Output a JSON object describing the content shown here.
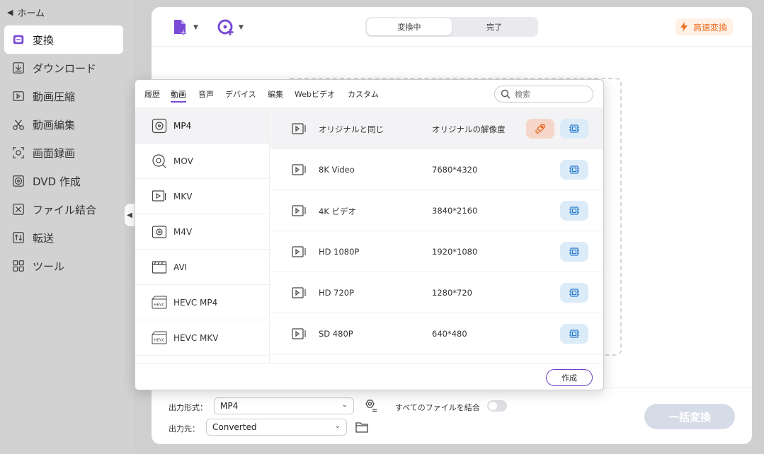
{
  "sidebar": {
    "home": "ホーム",
    "items": [
      {
        "label": "変換",
        "icon": "convert-icon",
        "active": true
      },
      {
        "label": "ダウンロード",
        "icon": "download-icon"
      },
      {
        "label": "動画圧縮",
        "icon": "compress-icon"
      },
      {
        "label": "動画編集",
        "icon": "scissors-icon"
      },
      {
        "label": "画面録画",
        "icon": "screen-record-icon"
      },
      {
        "label": "DVD 作成",
        "icon": "disc-icon"
      },
      {
        "label": "ファイル結合",
        "icon": "merge-icon"
      },
      {
        "label": "転送",
        "icon": "transfer-icon"
      },
      {
        "label": "ツール",
        "icon": "toolbox-icon"
      }
    ]
  },
  "topbar": {
    "tabs": [
      "変換中",
      "完了"
    ],
    "active_tab": "変換中",
    "fast_convert": "高速変換"
  },
  "popup": {
    "tabs": [
      "履歴",
      "動画",
      "音声",
      "デバイス",
      "編集",
      "Webビデオ",
      "カスタム"
    ],
    "active_tab": "動画",
    "search_placeholder": "検索",
    "formats": [
      "MP4",
      "MOV",
      "MKV",
      "M4V",
      "AVI",
      "HEVC MP4",
      "HEVC MKV"
    ],
    "selected_format": "MP4",
    "resolutions": [
      {
        "name": "オリジナルと同じ",
        "res": "オリジナルの解像度"
      },
      {
        "name": "8K Video",
        "res": "7680*4320"
      },
      {
        "name": "4K ビデオ",
        "res": "3840*2160"
      },
      {
        "name": "HD 1080P",
        "res": "1920*1080"
      },
      {
        "name": "HD 720P",
        "res": "1280*720"
      },
      {
        "name": "SD 480P",
        "res": "640*480"
      }
    ],
    "create": "作成"
  },
  "bottom": {
    "output_format_label": "出力形式：",
    "output_format_value": "MP4",
    "merge_label": "すべてのファイルを結合",
    "output_dest_label": "出力先：",
    "output_dest_value": "Converted",
    "convert_all": "一括変換"
  },
  "colors": {
    "accent": "#7a4ad6",
    "fast": "#ea6a1e",
    "rocket_bg": "#f6d6c8",
    "chip_bg": "#dcebf8"
  }
}
